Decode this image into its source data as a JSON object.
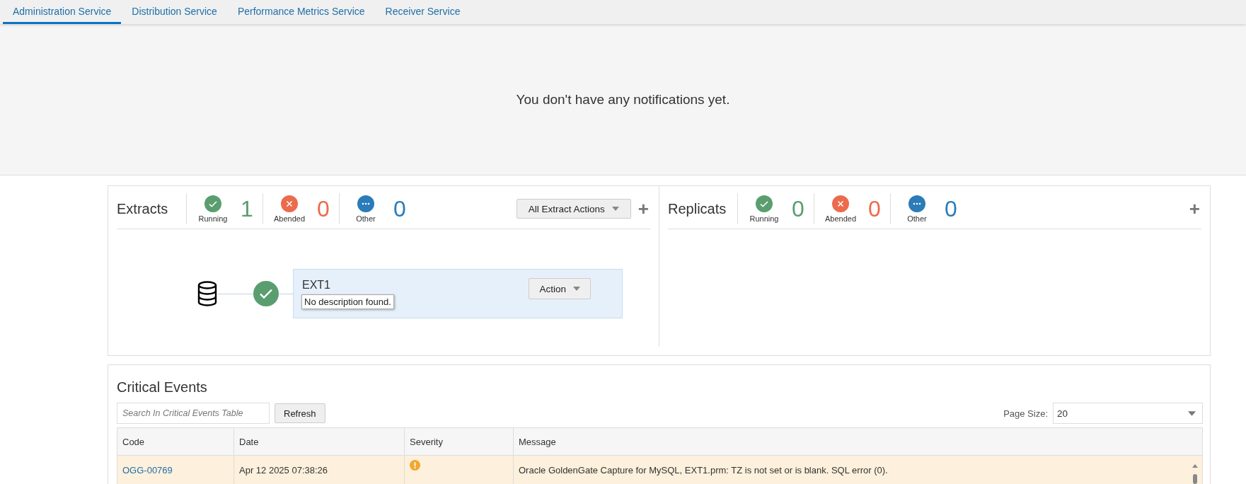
{
  "tabs": [
    {
      "label": "Administration Service",
      "selected": true
    },
    {
      "label": "Distribution Service",
      "selected": false
    },
    {
      "label": "Performance Metrics Service",
      "selected": false
    },
    {
      "label": "Receiver Service",
      "selected": false
    }
  ],
  "notifications": {
    "message": "You don't have any notifications yet."
  },
  "extracts": {
    "title": "Extracts",
    "stats": [
      {
        "kind": "running",
        "label": "Running",
        "count": "1"
      },
      {
        "kind": "abended",
        "label": "Abended",
        "count": "0"
      },
      {
        "kind": "other",
        "label": "Other",
        "count": "0"
      }
    ],
    "actions_button": "All Extract Actions",
    "plus": "+",
    "items": [
      {
        "name": "EXT1",
        "kind": "running",
        "action_button": "Action",
        "tooltip": "No description found."
      }
    ]
  },
  "replicats": {
    "title": "Replicats",
    "stats": [
      {
        "kind": "running",
        "label": "Running",
        "count": "0"
      },
      {
        "kind": "abended",
        "label": "Abended",
        "count": "0"
      },
      {
        "kind": "other",
        "label": "Other",
        "count": "0"
      }
    ],
    "plus": "+"
  },
  "critical_events": {
    "title": "Critical Events",
    "search": {
      "placeholder": "Search In Critical Events Table"
    },
    "refresh_button": "Refresh",
    "page_size_label": "Page Size:",
    "page_size": "20",
    "table": {
      "columns": [
        "Code",
        "Date",
        "Severity",
        "Message"
      ],
      "rows": [
        {
          "code": "OGG-00769",
          "date": "Apr 12 2025 07:38:26",
          "kind": "warning",
          "message": "Oracle GoldenGate Capture for MySQL, EXT1.prm: TZ is not set or is blank. SQL error (0)."
        }
      ]
    }
  }
}
